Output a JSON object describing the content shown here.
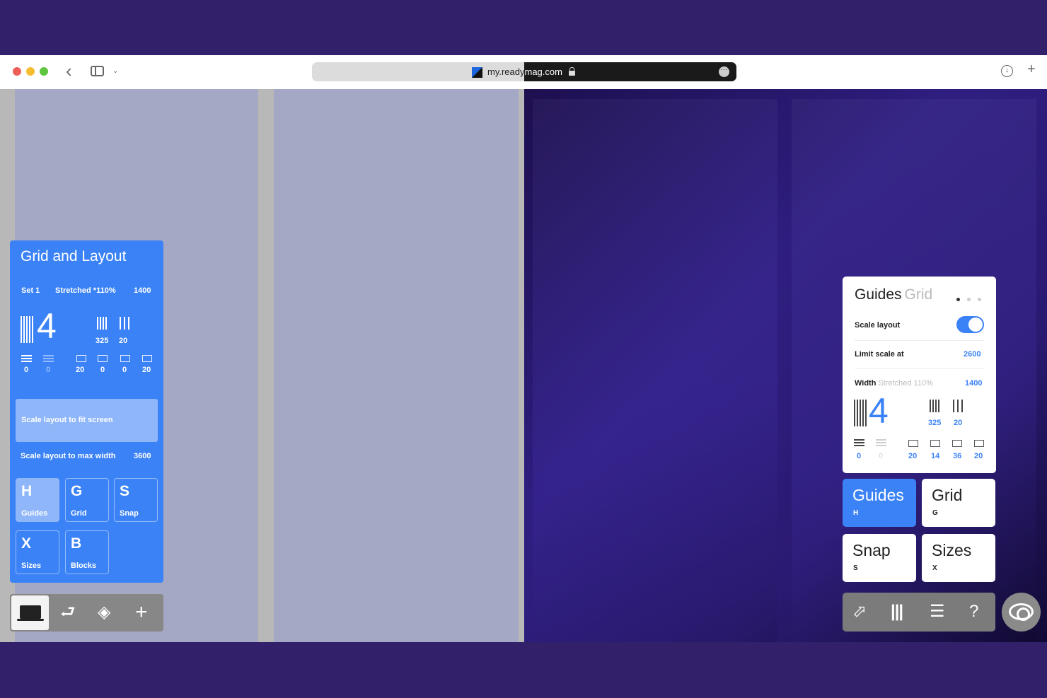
{
  "browser": {
    "url_part1": "my.ready",
    "url_part2": "mag.com",
    "back_glyph": "‹",
    "chevron_glyph": "⌄",
    "more_glyph": "···",
    "download_glyph": "↓",
    "new_tab_glyph": "+"
  },
  "editor_panel": {
    "title": "Grid and Layout",
    "set": "Set 1",
    "stretched": "Stretched *110%",
    "width": "1400",
    "columns": "4",
    "column_width": "325",
    "gutter": "20",
    "row_values": [
      "0",
      "0",
      "20",
      "0",
      "0",
      "20"
    ],
    "fit_label": "Scale layout to fit screen",
    "max_label": "Scale layout to max width",
    "max_value": "3600",
    "keys": [
      {
        "letter": "H",
        "label": "Guides"
      },
      {
        "letter": "G",
        "label": "Grid"
      },
      {
        "letter": "S",
        "label": "Snap"
      },
      {
        "letter": "X",
        "label": "Sizes"
      },
      {
        "letter": "B",
        "label": "Blocks"
      }
    ],
    "toolbar_glyphs": {
      "link": "⮐",
      "layers": "◈",
      "add": "+"
    }
  },
  "preview_panel": {
    "title_active": "Guides",
    "title_inactive": "Grid",
    "scale_layout_label": "Scale layout",
    "scale_layout_on": true,
    "limit_label": "Limit scale at",
    "limit_value": "2600",
    "width_label": "Width",
    "width_note": "Stretched 110%",
    "width_value": "1400",
    "columns": "4",
    "column_width": "325",
    "gutter": "20",
    "row_values": [
      "0",
      "0",
      "20",
      "14",
      "36",
      "20"
    ],
    "keys": [
      {
        "name": "Guides",
        "hotkey": "H"
      },
      {
        "name": "Grid",
        "hotkey": "G"
      },
      {
        "name": "Snap",
        "hotkey": "S"
      },
      {
        "name": "Sizes",
        "hotkey": "X"
      }
    ],
    "toolbar_glyphs": {
      "cursor": "⬀",
      "columns": "|||",
      "rows": "☰",
      "help": "?"
    }
  },
  "colors": {
    "background": "#32206a",
    "accent": "#3b82f6",
    "accent_light": "#8fb6f8"
  }
}
